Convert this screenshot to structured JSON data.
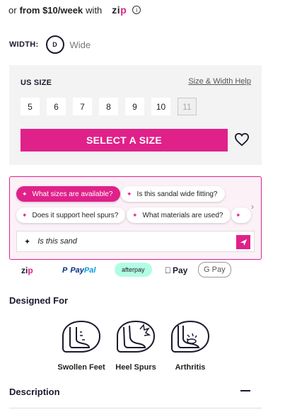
{
  "zip": {
    "prefix": "or",
    "price": "from $10/week",
    "with": "with",
    "logo_left": "zi",
    "logo_right": "p",
    "info_glyph": "i"
  },
  "width": {
    "label": "WIDTH:",
    "code": "D",
    "value": "Wide"
  },
  "size_panel": {
    "title": "US SIZE",
    "help_link": "Size & Width Help",
    "sizes": [
      {
        "label": "5",
        "available": true
      },
      {
        "label": "6",
        "available": true
      },
      {
        "label": "7",
        "available": true
      },
      {
        "label": "8",
        "available": true
      },
      {
        "label": "9",
        "available": true
      },
      {
        "label": "10",
        "available": true
      },
      {
        "label": "11",
        "available": false
      }
    ],
    "select_button": "SELECT A SIZE",
    "wishlist_icon": "heart-outline-icon"
  },
  "ai_assistant": {
    "chips": [
      {
        "label": "What sizes are available?",
        "active": true
      },
      {
        "label": "Is this sandal wide fitting?",
        "active": false
      },
      {
        "label": "Does it support heel spurs?",
        "active": false
      },
      {
        "label": "What materials are used?",
        "active": false
      },
      {
        "label": "",
        "active": false
      }
    ],
    "sparkle_icon": "sparkle-icon",
    "input_value": "Is this sand",
    "send_icon": "send-icon",
    "scroll_icon": "chevron-right-icon"
  },
  "payments": {
    "zip_left": "zi",
    "zip_right": "p",
    "paypal_1": "Pay",
    "paypal_2": "Pal",
    "afterpay": "afterpay",
    "apple_pay": "Pay",
    "google_pay": "G Pay"
  },
  "designed_for": {
    "title": "Designed For",
    "items": [
      {
        "label": "Swollen Feet",
        "icon": "swollen-feet-icon"
      },
      {
        "label": "Heel Spurs",
        "icon": "heel-spurs-icon"
      },
      {
        "label": "Arthritis",
        "icon": "arthritis-icon"
      }
    ]
  },
  "description": {
    "title": "Description",
    "toggle_icon": "minus-icon"
  },
  "colors": {
    "brand": "#e0218a",
    "text": "#1a1a2e",
    "panel_bg": "#f3f3f3"
  }
}
